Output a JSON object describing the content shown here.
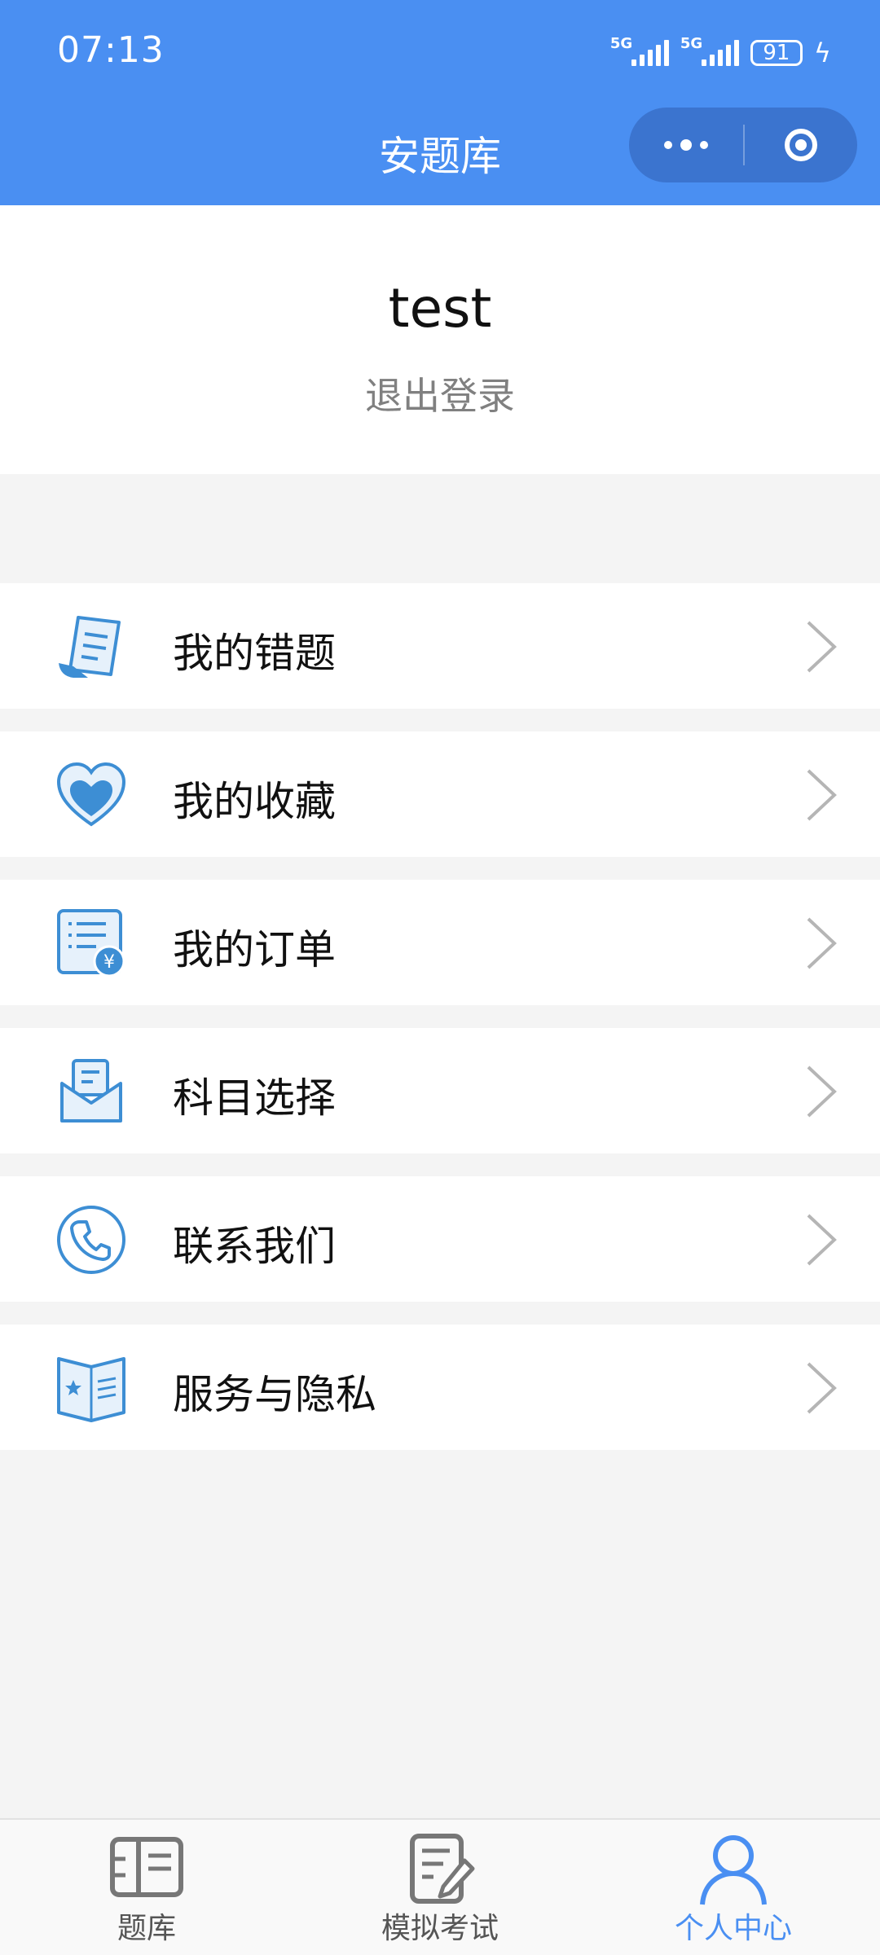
{
  "status_bar": {
    "time": "07:13",
    "signal1_label": "5G",
    "signal2_label": "5G",
    "battery": "91"
  },
  "nav": {
    "title": "安题库"
  },
  "profile": {
    "username": "test",
    "logout_label": "退出登录"
  },
  "menu": [
    {
      "label": "我的错题",
      "icon": "wrong-questions-icon"
    },
    {
      "label": "我的收藏",
      "icon": "heart-icon"
    },
    {
      "label": "我的订单",
      "icon": "order-icon"
    },
    {
      "label": "科目选择",
      "icon": "subject-icon"
    },
    {
      "label": "联系我们",
      "icon": "phone-icon"
    },
    {
      "label": "服务与隐私",
      "icon": "book-icon"
    }
  ],
  "tabs": [
    {
      "label": "题库",
      "icon": "question-bank-icon"
    },
    {
      "label": "模拟考试",
      "icon": "exam-icon"
    },
    {
      "label": "个人中心",
      "icon": "person-icon",
      "active": true
    }
  ],
  "colors": {
    "primary": "#4a8ff2",
    "capsule": "#3b74cf",
    "icon_blue": "#3d8ed4",
    "background": "#f4f4f4"
  }
}
